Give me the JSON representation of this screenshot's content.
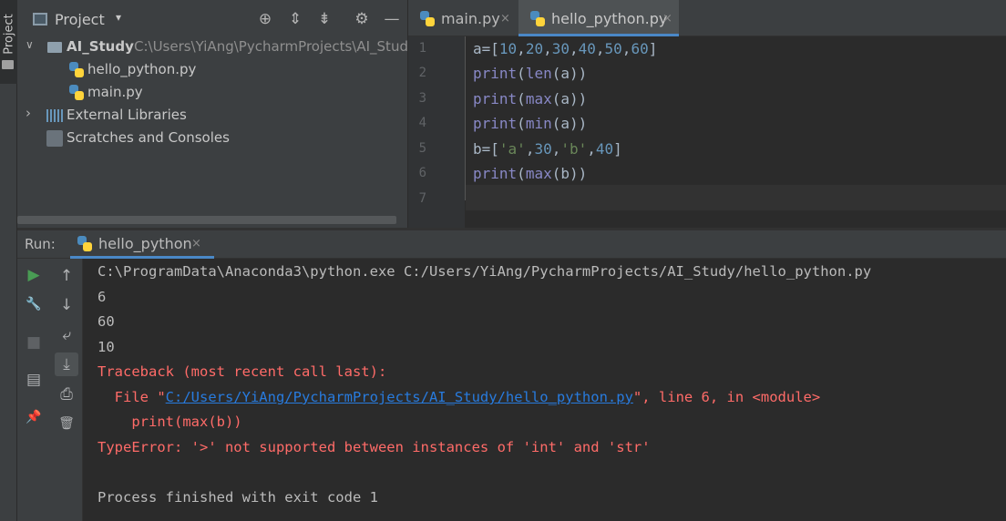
{
  "side_tab": {
    "label": "Project"
  },
  "project_panel": {
    "title": "Project",
    "dropdown": "▾",
    "header_buttons": [
      {
        "name": "locate-icon",
        "glyph": "⊕"
      },
      {
        "name": "expand-all-icon",
        "glyph": "⇕"
      },
      {
        "name": "collapse-all-icon",
        "glyph": "⇟"
      },
      {
        "name": "gear-icon",
        "glyph": "⚙"
      },
      {
        "name": "hide-icon",
        "glyph": "—"
      }
    ],
    "tree": {
      "root_arrow": "∨",
      "root_name": "AI_Study",
      "root_path": "C:\\Users\\YiAng\\PycharmProjects\\AI_Study",
      "files": [
        "hello_python.py",
        "main.py"
      ],
      "ext_arrow": "›",
      "external_libraries": "External Libraries",
      "scratches": "Scratches and Consoles"
    }
  },
  "editor": {
    "tabs": [
      {
        "label": "main.py",
        "close": "×"
      },
      {
        "label": "hello_python.py",
        "close": "×"
      }
    ],
    "line_numbers": [
      "1",
      "2",
      "3",
      "4",
      "5",
      "6",
      "7"
    ],
    "code": {
      "l1_a": "a",
      "l1_b": "=[",
      "l1_n1": "10",
      "l1_c1": ",",
      "l1_n2": "20",
      "l1_c2": ",",
      "l1_n3": "30",
      "l1_c3": ",",
      "l1_n4": "40",
      "l1_c4": ",",
      "l1_n5": "50",
      "l1_c5": ",",
      "l1_n6": "60",
      "l1_end": "]",
      "l2_fn": "print",
      "l2_p": "(",
      "l2_fn2": "len",
      "l2_rest": "(a))",
      "l3_fn": "print",
      "l3_p": "(",
      "l3_fn2": "max",
      "l3_rest": "(a))",
      "l4_fn": "print",
      "l4_p": "(",
      "l4_fn2": "min",
      "l4_rest": "(a))",
      "l5_b": "b",
      "l5_eq": "=[",
      "l5_s1": "'a'",
      "l5_c1": ",",
      "l5_n1": "30",
      "l5_c2": ",",
      "l5_s2": "'b'",
      "l5_c3": ",",
      "l5_n2": "40",
      "l5_end": "]",
      "l6_fn": "print",
      "l6_p": "(",
      "l6_fn2": "max",
      "l6_rest": "(b))"
    }
  },
  "run_panel": {
    "label": "Run:",
    "tab_label": "hello_python",
    "tab_close": "×",
    "toolbar_left": [
      {
        "name": "rerun-icon",
        "glyph": "▶"
      },
      {
        "name": "wrench-icon",
        "glyph": "🔧"
      },
      {
        "name": "stop-icon",
        "glyph": "■"
      },
      {
        "name": "layout-icon",
        "glyph": "▤"
      },
      {
        "name": "pin-icon",
        "glyph": "📌"
      }
    ],
    "toolbar_right": [
      {
        "name": "scroll-up-icon",
        "glyph": "↑"
      },
      {
        "name": "scroll-down-icon",
        "glyph": "↓"
      },
      {
        "name": "soft-wrap-icon",
        "glyph": "⤶"
      },
      {
        "name": "scroll-to-end-icon",
        "glyph": "⤓"
      },
      {
        "name": "print-icon",
        "glyph": "⎙"
      },
      {
        "name": "trash-icon",
        "glyph": "🗑"
      }
    ],
    "console": {
      "command": "C:\\ProgramData\\Anaconda3\\python.exe C:/Users/YiAng/PycharmProjects/AI_Study/hello_python.py",
      "out1": "6",
      "out2": "60",
      "out3": "10",
      "traceback": "Traceback (most recent call last):",
      "file_prefix": "  File \"",
      "file_link": "C:/Users/YiAng/PycharmProjects/AI_Study/hello_python.py",
      "file_suffix": "\", line 6, in <module>",
      "code_line": "    print(max(b))",
      "error": "TypeError: '>' not supported between instances of 'int' and 'str'",
      "exit": "Process finished with exit code 1"
    }
  },
  "colors": {
    "background": "#2b2b2b",
    "panel": "#3c3f41",
    "error": "#ff6b68",
    "link": "#287bde",
    "accent": "#4a88c7",
    "run_green": "#499c54"
  }
}
